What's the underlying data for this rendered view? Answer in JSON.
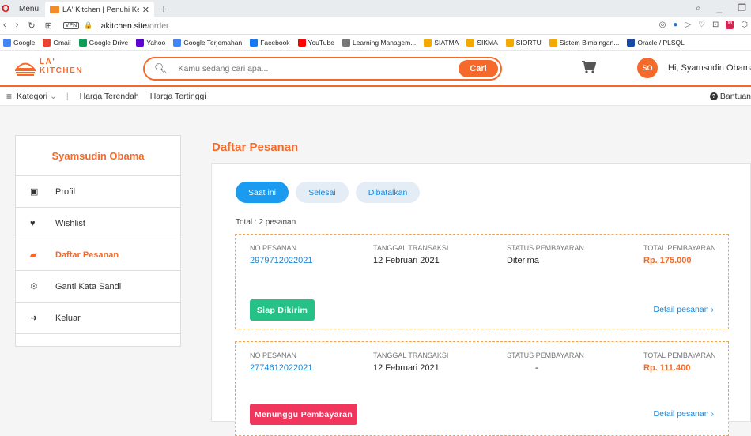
{
  "browser": {
    "menu_label": "Menu",
    "tab_title": "LA' Kitchen | Penuhi Kebutu",
    "url_host": "lakitchen.site",
    "url_path": "/order",
    "vpn_label": "VPN",
    "bookmarks": [
      "Google",
      "Gmail",
      "Google Drive",
      "Yahoo",
      "Google Terjemahan",
      "Facebook",
      "YouTube",
      "Learning Managem...",
      "SIATMA",
      "SIKMA",
      "SIORTU",
      "Sistem Bimbingan...",
      "Oracle / PLSQL"
    ],
    "bookmark_colors": [
      "#4285f4",
      "#ea4335",
      "#0f9d58",
      "#5f01d1",
      "#4285f4",
      "#1877f2",
      "#ff0000",
      "#777777",
      "#f2a900",
      "#f2a900",
      "#f2a900",
      "#f2a900",
      "#1a4aa0"
    ]
  },
  "header": {
    "logo_line1": "LA'",
    "logo_line2": "KITCHEN",
    "search_placeholder": "Kamu sedang cari apa...",
    "search_button": "Cari",
    "avatar_initials": "SO",
    "greeting": "Hi, Syamsudin Obama",
    "accent_color": "#f56a2a"
  },
  "catbar": {
    "category_label": "Kategori",
    "filter_low": "Harga Terendah",
    "filter_high": "Harga Tertinggi",
    "help_label": "Bantuan"
  },
  "sidebar": {
    "user_name": "Syamsudin Obama",
    "items": [
      {
        "label": "Profil",
        "icon": "id-badge-icon"
      },
      {
        "label": "Wishlist",
        "icon": "heart-icon"
      },
      {
        "label": "Daftar Pesanan",
        "icon": "orders-icon"
      },
      {
        "label": "Ganti Kata Sandi",
        "icon": "gears-icon"
      },
      {
        "label": "Keluar",
        "icon": "logout-icon"
      }
    ]
  },
  "main": {
    "title": "Daftar Pesanan",
    "tabs": [
      "Saat ini",
      "Selesai",
      "Dibatalkan"
    ],
    "total_text": "Total : 2 pesanan",
    "columns": [
      "NO PESANAN",
      "TANGGAL TRANSAKSI",
      "STATUS PEMBAYARAN",
      "TOTAL PEMBAYARAN"
    ],
    "detail_label": "Detail pesanan",
    "orders": [
      {
        "no": "2979712022021",
        "date": "12 Februari 2021",
        "payment_status": "Diterima",
        "total": "Rp. 175.000",
        "status_label": "Siap Dikirim",
        "status_color": "#26c186"
      },
      {
        "no": "2774612022021",
        "date": "12 Februari 2021",
        "payment_status": "-",
        "total": "Rp. 111.400",
        "status_label": "Menunggu Pembayaran",
        "status_color": "#f0365d"
      }
    ]
  }
}
